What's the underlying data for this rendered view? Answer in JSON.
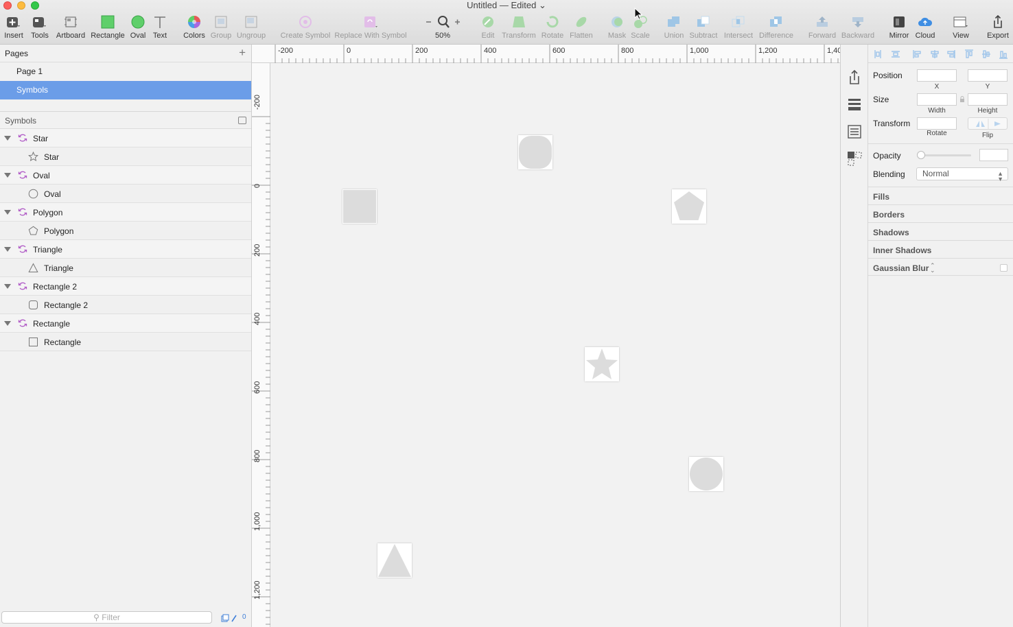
{
  "window": {
    "title": "Untitled — Edited"
  },
  "toolbar": {
    "insert": "Insert",
    "tools": "Tools",
    "artboard": "Artboard",
    "rectangle": "Rectangle",
    "oval": "Oval",
    "text": "Text",
    "colors": "Colors",
    "group": "Group",
    "ungroup": "Ungroup",
    "create_symbol": "Create Symbol",
    "replace_with_symbol": "Replace With Symbol",
    "zoom_level": "50%",
    "edit": "Edit",
    "transform": "Transform",
    "rotate": "Rotate",
    "flatten": "Flatten",
    "mask": "Mask",
    "scale": "Scale",
    "union": "Union",
    "subtract": "Subtract",
    "intersect": "Intersect",
    "difference": "Difference",
    "forward": "Forward",
    "backward": "Backward",
    "mirror": "Mirror",
    "cloud": "Cloud",
    "view": "View",
    "export": "Export"
  },
  "pages": {
    "header": "Pages",
    "items": [
      {
        "label": "Page 1"
      },
      {
        "label": "Symbols"
      }
    ]
  },
  "layers": {
    "header": "Symbols",
    "items": [
      {
        "group": "Star",
        "child": "Star"
      },
      {
        "group": "Oval",
        "child": "Oval"
      },
      {
        "group": "Polygon",
        "child": "Polygon"
      },
      {
        "group": "Triangle",
        "child": "Triangle"
      },
      {
        "group": "Rectangle 2",
        "child": "Rectangle 2"
      },
      {
        "group": "Rectangle",
        "child": "Rectangle"
      }
    ],
    "filter_placeholder": "Filter",
    "filter_count": "0"
  },
  "rulers": {
    "horizontal": [
      "-200",
      "0",
      "200",
      "400",
      "600",
      "800",
      "1,000",
      "1,200",
      "1,40"
    ],
    "vertical": [
      "-200",
      "0",
      "200",
      "400",
      "600",
      "800",
      "1,000",
      "1,200"
    ]
  },
  "inspector": {
    "position": "Position",
    "x": "X",
    "y": "Y",
    "size": "Size",
    "width": "Width",
    "height": "Height",
    "transform": "Transform",
    "rotate": "Rotate",
    "flip": "Flip",
    "opacity": "Opacity",
    "blending": "Blending",
    "blending_value": "Normal",
    "fills": "Fills",
    "borders": "Borders",
    "shadows": "Shadows",
    "inner_shadows": "Inner Shadows",
    "gaussian_blur": "Gaussian Blur"
  }
}
